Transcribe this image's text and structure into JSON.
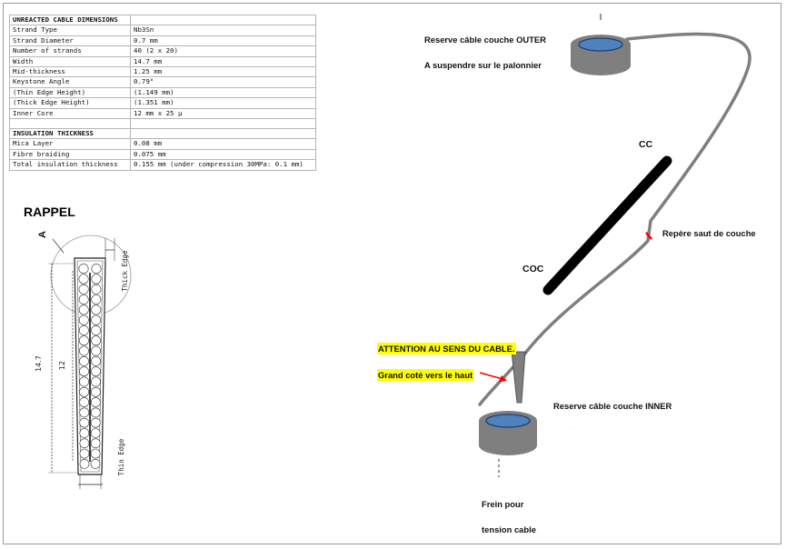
{
  "spec_table": {
    "sections": [
      {
        "heading": "UNREACTED CABLE DIMENSIONS",
        "rows": [
          {
            "key": "Strand Type",
            "value": "Nb3Sn"
          },
          {
            "key": "Strand Diameter",
            "value": "0.7 mm"
          },
          {
            "key": "Number of strands",
            "value": "40 (2 x 20)"
          },
          {
            "key": "Width",
            "value": "14.7 mm"
          },
          {
            "key": "Mid-thickness",
            "value": "1.25 mm"
          },
          {
            "key": "Keystone Angle",
            "value": "0.79°"
          },
          {
            "key": "(Thin Edge Height)",
            "value": "(1.149 mm)"
          },
          {
            "key": "(Thick Edge Height)",
            "value": "(1.351 mm)"
          },
          {
            "key": "Inner Core",
            "value": "12 mm x 25 μ"
          }
        ]
      },
      {
        "heading": "INSULATION THICKNESS",
        "rows": [
          {
            "key": "Mica Layer",
            "value": "0.08 mm"
          },
          {
            "key": "Fibre braiding",
            "value": "0.075 mm"
          },
          {
            "key": "Total insulation thickness",
            "value": "0.155 mm (under compression 30MPa: 0.1 mm)"
          }
        ]
      }
    ]
  },
  "rappel": {
    "title": "RAPPEL",
    "detail_letter": "A",
    "dim_outer": "14.7",
    "dim_inner": "12",
    "thick_edge": "Thick Edge",
    "thin_edge": "Thin Edge",
    "strand_rows": 20
  },
  "labels": {
    "outer_reserve": "Reserve câble couche OUTER",
    "outer_hang": "A suspendre sur le palonnier",
    "cc": "CC",
    "coc": "COC",
    "layer_jump": "Repère saut de couche",
    "attention": "ATTENTION AU SENS DU CABLE.",
    "big_side": "Grand coté vers le haut",
    "inner_reserve": "Reserve câble couche INNER",
    "brake_1": "Frein pour",
    "brake_2": "tension cable"
  },
  "colors": {
    "spool_gray": "#7f7f7f",
    "spool_blue": "#4f81bd",
    "cable_gray": "#7f7f7f",
    "tool_black": "#000000",
    "arrow_red": "#ff0000",
    "highlight": "#ffff00"
  }
}
